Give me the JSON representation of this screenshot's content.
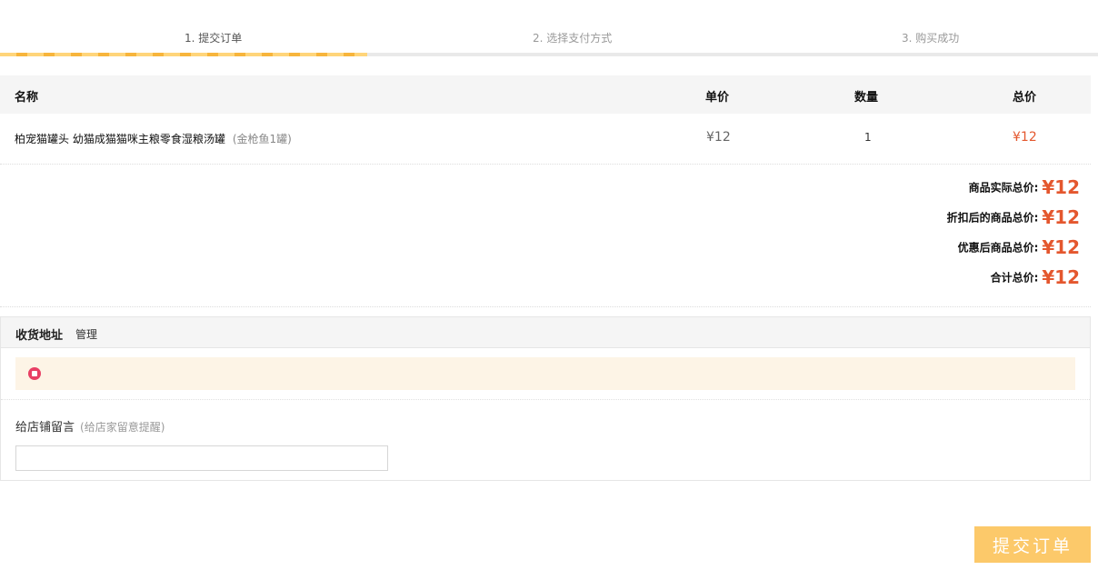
{
  "steps": [
    {
      "label": "1. 提交订单",
      "state": "active"
    },
    {
      "label": "2. 选择支付方式",
      "state": "pending"
    },
    {
      "label": "3. 购买成功",
      "state": "pending"
    }
  ],
  "table": {
    "headers": {
      "name": "名称",
      "unit_price": "单价",
      "quantity": "数量",
      "total": "总价"
    },
    "rows": [
      {
        "name": "柏宠猫罐头 幼猫成猫猫咪主粮零食湿粮汤罐",
        "spec": "(金枪鱼1罐)",
        "unit_price": "¥12",
        "quantity": "1",
        "total": "¥12"
      }
    ]
  },
  "summary": [
    {
      "label": "商品实际总价:",
      "value": "¥12"
    },
    {
      "label": "折扣后的商品总价:",
      "value": "¥12"
    },
    {
      "label": "优惠后商品总价:",
      "value": "¥12"
    },
    {
      "label": "合计总价:",
      "value": "¥12"
    }
  ],
  "address": {
    "title": "收货地址",
    "manage_link": "管理"
  },
  "message": {
    "label": "给店铺留言",
    "hint": "(给店家留意提醒)",
    "value": "",
    "placeholder": ""
  },
  "submit_label": "提交订单",
  "colors": {
    "accent_price": "#e4572e",
    "submit_bg": "#fcc96a",
    "radio": "#e83f64",
    "step_active": "#f7b53c"
  }
}
